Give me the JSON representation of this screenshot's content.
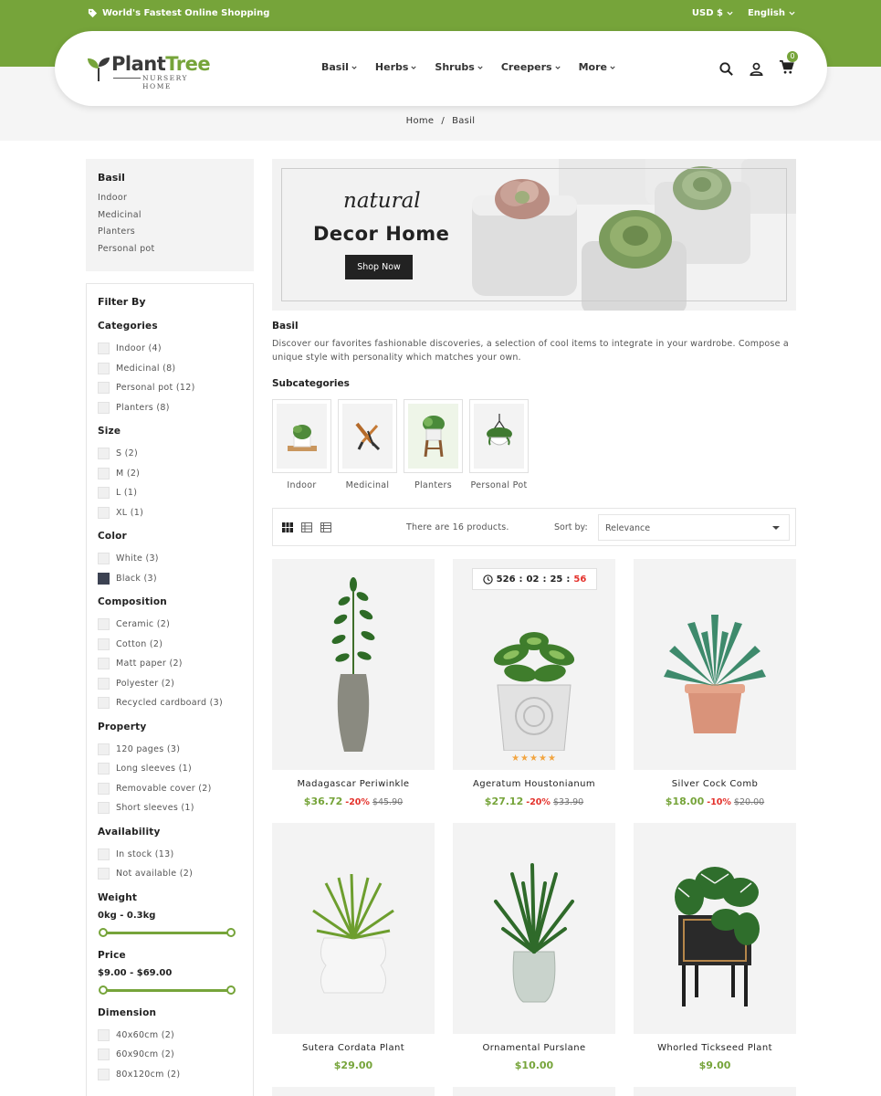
{
  "topbar": {
    "tagline": "World's Fastest Online Shopping",
    "currency": "USD $",
    "language": "English"
  },
  "brand": {
    "name_part1": "Plant",
    "name_part2": "Tree",
    "subtitle": "NURSERY HOME",
    "accent": "#76a43a"
  },
  "nav": {
    "items": [
      {
        "label": "Basil"
      },
      {
        "label": "Herbs"
      },
      {
        "label": "Shrubs"
      },
      {
        "label": "Creepers"
      },
      {
        "label": "More"
      }
    ],
    "cart_count": "0",
    "icons": [
      "search-icon",
      "user-icon",
      "cart-icon"
    ]
  },
  "breadcrumb": {
    "home": "Home",
    "sep": "/",
    "current": "Basil"
  },
  "sidebar": {
    "category_title": "Basil",
    "category_links": [
      "Indoor",
      "Medicinal",
      "Planters",
      "Personal pot"
    ],
    "filter_title": "Filter By",
    "groups": {
      "categories": {
        "title": "Categories",
        "options": [
          "Indoor (4)",
          "Medicinal (8)",
          "Personal pot (12)",
          "Planters (8)"
        ]
      },
      "size": {
        "title": "Size",
        "options": [
          "S (2)",
          "M (2)",
          "L (1)",
          "XL (1)"
        ]
      },
      "color": {
        "title": "Color",
        "options": [
          "White (3)",
          "Black (3)"
        ]
      },
      "composition": {
        "title": "Composition",
        "options": [
          "Ceramic (2)",
          "Cotton (2)",
          "Matt paper (2)",
          "Polyester (2)",
          "Recycled cardboard (3)"
        ]
      },
      "property": {
        "title": "Property",
        "options": [
          "120 pages (3)",
          "Long sleeves (1)",
          "Removable cover (2)",
          "Short sleeves (1)"
        ]
      },
      "availability": {
        "title": "Availability",
        "options": [
          "In stock (13)",
          "Not available (2)"
        ]
      },
      "weight": {
        "title": "Weight",
        "range": "0kg - 0.3kg"
      },
      "price": {
        "title": "Price",
        "range": "$9.00 - $69.00"
      },
      "dimension": {
        "title": "Dimension",
        "options": [
          "40x60cm (2)",
          "60x90cm (2)",
          "80x120cm (2)"
        ]
      }
    }
  },
  "banner": {
    "script": "natural",
    "heading": "Decor Home",
    "button": "Shop Now"
  },
  "category": {
    "name": "Basil",
    "description": "Discover our favorites fashionable discoveries, a selection of cool items to integrate in your wardrobe. Compose a unique style with personality which matches your own.",
    "subcategories_title": "Subcategories",
    "subcategories": [
      {
        "label": "Indoor"
      },
      {
        "label": "Medicinal"
      },
      {
        "label": "Planters"
      },
      {
        "label": "Personal Pot"
      }
    ]
  },
  "toolbar": {
    "count_text": "There are 16 products.",
    "sort_label": "Sort by:",
    "sort_value": "Relevance"
  },
  "products": [
    {
      "name": "Madagascar Periwinkle",
      "price": "$36.72",
      "discount": "-20%",
      "old_price": "$45.90"
    },
    {
      "name": "Ageratum Houstonianum",
      "price": "$27.12",
      "discount": "-20%",
      "old_price": "$33.90",
      "timer": {
        "days": "526",
        "hours": "02",
        "minutes": "25",
        "seconds": "56"
      },
      "stars": "★★★★★"
    },
    {
      "name": "Silver Cock Comb",
      "price": "$18.00",
      "discount": "-10%",
      "old_price": "$20.00"
    },
    {
      "name": "Sutera Cordata Plant",
      "price": "$29.00"
    },
    {
      "name": "Ornamental Purslane",
      "price": "$10.00"
    },
    {
      "name": "Whorled Tickseed Plant",
      "price": "$9.00"
    }
  ]
}
